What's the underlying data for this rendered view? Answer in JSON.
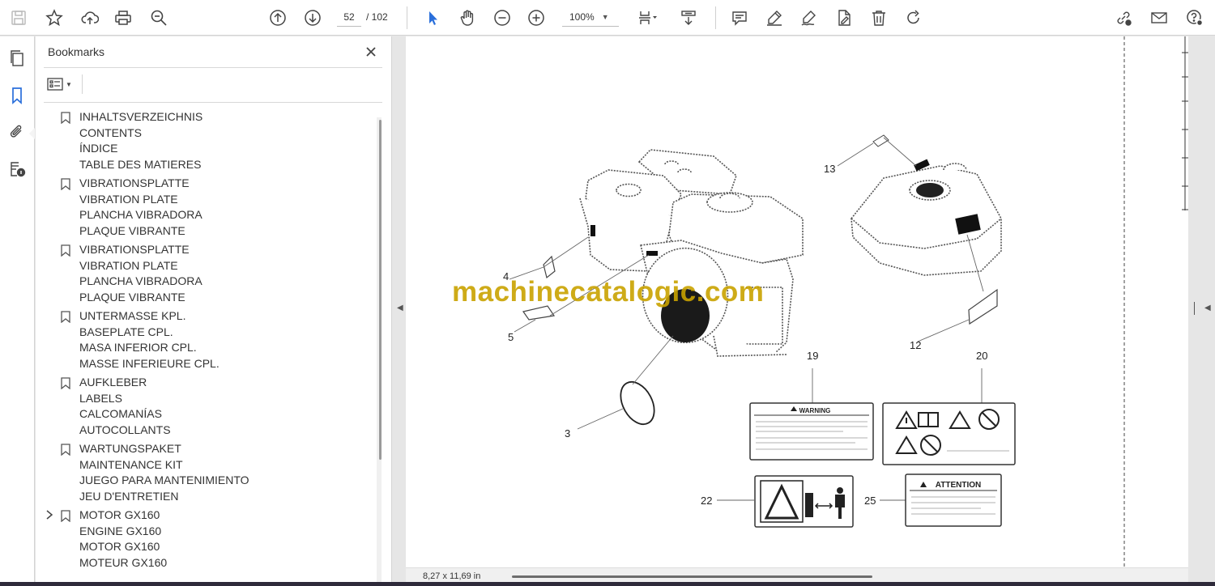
{
  "toolbar": {
    "page_current": "52",
    "page_total": "/  102",
    "zoom": "100%"
  },
  "bookmarks": {
    "title": "Bookmarks",
    "items": [
      {
        "lines": [
          "INHALTSVERZEICHNIS",
          "CONTENTS",
          "ÍNDICE",
          "TABLE DES MATIERES"
        ],
        "expandable": false
      },
      {
        "lines": [
          "VIBRATIONSPLATTE",
          "VIBRATION PLATE",
          "PLANCHA VIBRADORA",
          "PLAQUE VIBRANTE"
        ],
        "expandable": false
      },
      {
        "lines": [
          "VIBRATIONSPLATTE",
          "VIBRATION PLATE",
          "PLANCHA VIBRADORA",
          "PLAQUE VIBRANTE"
        ],
        "expandable": false
      },
      {
        "lines": [
          "UNTERMASSE KPL.",
          "BASEPLATE CPL.",
          "MASA INFERIOR CPL.",
          "MASSE INFERIEURE CPL."
        ],
        "expandable": false
      },
      {
        "lines": [
          "AUFKLEBER",
          "LABELS",
          "CALCOMANÍAS",
          "AUTOCOLLANTS"
        ],
        "expandable": false
      },
      {
        "lines": [
          "WARTUNGSPAKET",
          "MAINTENANCE KIT",
          "JUEGO PARA MANTENIMIENTO",
          "JEU D'ENTRETIEN"
        ],
        "expandable": false
      },
      {
        "lines": [
          "MOTOR GX160",
          "ENGINE GX160",
          "MOTOR GX160",
          "MOTEUR GX160"
        ],
        "expandable": true
      }
    ]
  },
  "document": {
    "watermark": "machinecatalogic.com",
    "callouts": [
      "4",
      "5",
      "3",
      "13",
      "12",
      "19",
      "20",
      "22",
      "25"
    ],
    "label_warning": "WARNING",
    "label_attention": "ATTENTION",
    "page_size": "8,27 x 11,69 in"
  }
}
